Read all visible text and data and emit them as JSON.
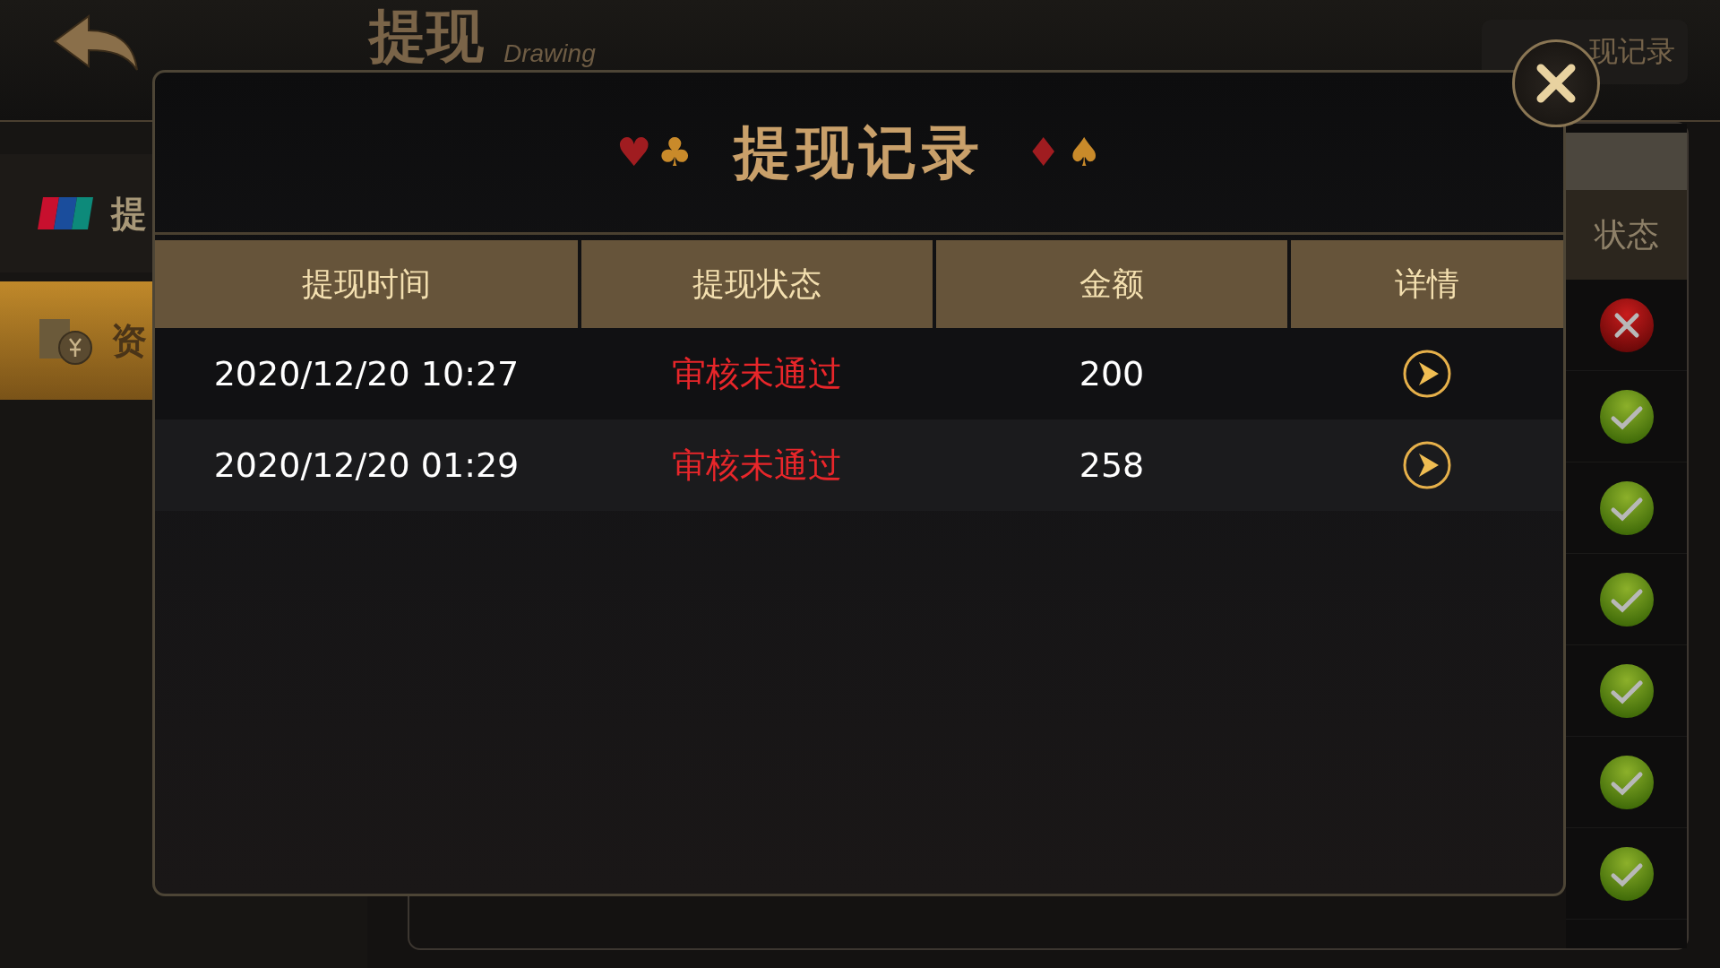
{
  "header": {
    "title": "提现",
    "subtitle": "Drawing",
    "records_button": "现记录"
  },
  "sidebar": {
    "items": [
      {
        "label": "提",
        "kind": "bank_card",
        "selected": false
      },
      {
        "label": "资",
        "kind": "funds",
        "selected": true
      }
    ]
  },
  "status_column": {
    "heading": "状态",
    "rows": [
      {
        "kind": "rejected"
      },
      {
        "kind": "approved"
      },
      {
        "kind": "approved"
      },
      {
        "kind": "approved"
      },
      {
        "kind": "approved"
      },
      {
        "kind": "approved"
      },
      {
        "kind": "approved"
      }
    ]
  },
  "dialog": {
    "title": "提现记录",
    "suits_left": [
      {
        "glyph": "♥",
        "color": "#a01c20"
      },
      {
        "glyph": "♣",
        "color": "#c98a2a"
      }
    ],
    "suits_right": [
      {
        "glyph": "♦",
        "color": "#a01c20"
      },
      {
        "glyph": "♠",
        "color": "#c98a2a"
      }
    ],
    "columns": [
      "提现时间",
      "提现状态",
      "金额",
      "详情"
    ],
    "rows": [
      {
        "time": "2020/12/20 10:27",
        "status": "审核未通过",
        "kind": "rejected",
        "amount": "200"
      },
      {
        "time": "2020/12/20 01:29",
        "status": "审核未通过",
        "kind": "rejected",
        "amount": "258"
      }
    ]
  }
}
